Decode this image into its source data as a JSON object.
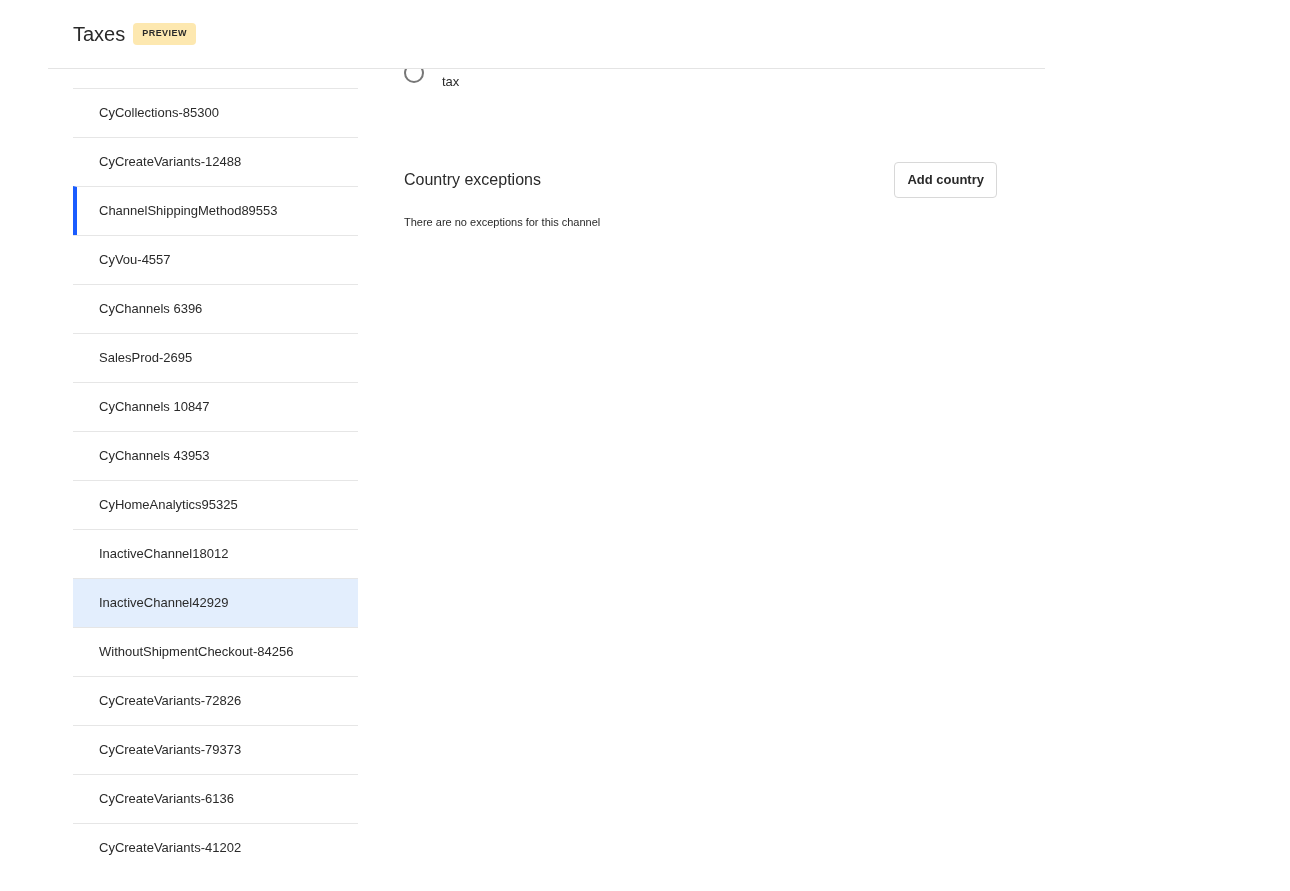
{
  "header": {
    "title": "Taxes",
    "badge": "PREVIEW"
  },
  "channels": [
    {
      "name": "CyCollections-85300",
      "selected": false,
      "highlighted": false
    },
    {
      "name": "CyCreateVariants-12488",
      "selected": false,
      "highlighted": false
    },
    {
      "name": "ChannelShippingMethod89553",
      "selected": true,
      "highlighted": false
    },
    {
      "name": "CyVou-4557",
      "selected": false,
      "highlighted": false
    },
    {
      "name": "CyChannels 6396",
      "selected": false,
      "highlighted": false
    },
    {
      "name": "SalesProd-2695",
      "selected": false,
      "highlighted": false
    },
    {
      "name": "CyChannels 10847",
      "selected": false,
      "highlighted": false
    },
    {
      "name": "CyChannels 43953",
      "selected": false,
      "highlighted": false
    },
    {
      "name": "CyHomeAnalytics95325",
      "selected": false,
      "highlighted": false
    },
    {
      "name": "InactiveChannel18012",
      "selected": false,
      "highlighted": false
    },
    {
      "name": "InactiveChannel42929",
      "selected": false,
      "highlighted": true
    },
    {
      "name": "WithoutShipmentCheckout-84256",
      "selected": false,
      "highlighted": false
    },
    {
      "name": "CyCreateVariants-72826",
      "selected": false,
      "highlighted": false
    },
    {
      "name": "CyCreateVariants-79373",
      "selected": false,
      "highlighted": false
    },
    {
      "name": "CyCreateVariants-6136",
      "selected": false,
      "highlighted": false
    },
    {
      "name": "CyCreateVariants-41202",
      "selected": false,
      "highlighted": false
    }
  ],
  "tax_option": {
    "label": "tax",
    "selected": false
  },
  "country_exceptions": {
    "title": "Country exceptions",
    "button": "Add country",
    "empty_text": "There are no exceptions for this channel"
  }
}
